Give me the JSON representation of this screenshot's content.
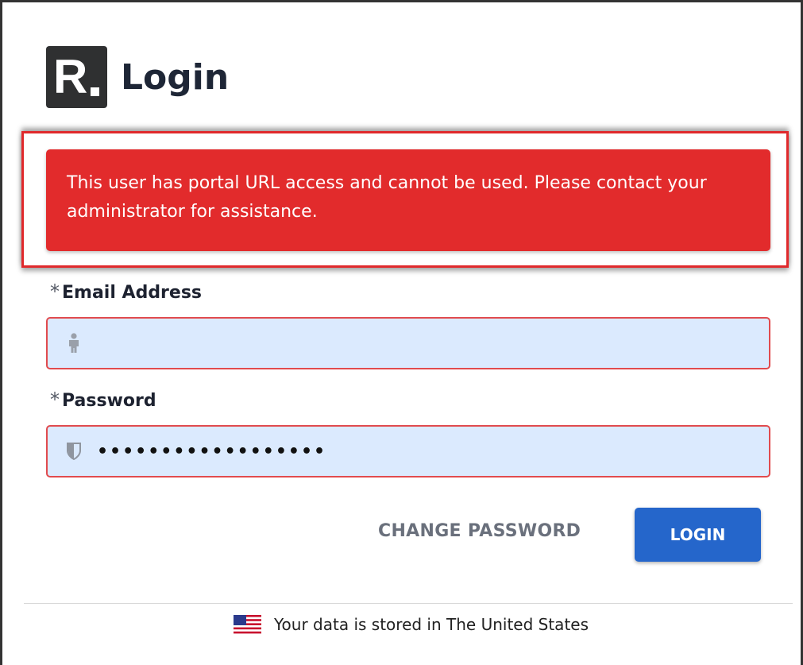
{
  "header": {
    "logo_letter": "R",
    "title": "Login"
  },
  "alert": {
    "message": "This user has portal URL access and cannot be used. Please contact your administrator for assistance."
  },
  "form": {
    "email": {
      "required_mark": "*",
      "label": "Email Address",
      "value": "",
      "icon": "person-icon"
    },
    "password": {
      "required_mark": "*",
      "label": "Password",
      "value": "••••••••••••••••••",
      "icon": "shield-icon"
    }
  },
  "actions": {
    "change_password_label": "CHANGE PASSWORD",
    "login_label": "LOGIN"
  },
  "footer": {
    "text": "Your data is stored in The United States",
    "icon": "us-flag-icon"
  },
  "colors": {
    "alert_bg": "#e22b2c",
    "input_bg": "#dbeafe",
    "input_border": "#e14b4e",
    "primary_button": "#2566cb",
    "title_text": "#1e2636"
  }
}
